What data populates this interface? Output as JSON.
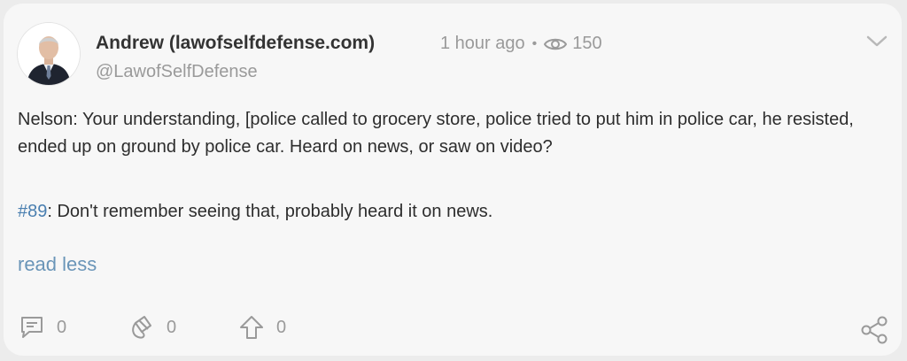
{
  "post": {
    "author_name": "Andrew (lawofselfdefense.com)",
    "time_ago": "1 hour ago",
    "separator": "•",
    "views": "150",
    "handle": "@LawofSelfDefense",
    "body_line1": "Nelson: Your understanding, [police called to grocery store, police tried to put him in police car, he resisted, ended up on ground by police car. Heard on news, or saw on video?",
    "body_tag": "#89",
    "body_line2_rest": ": Don't remember seeing that, probably heard it on news.",
    "read_less": "read less"
  },
  "actions": {
    "comments": "0",
    "reposts": "0",
    "upvotes": "0"
  },
  "icons": [
    "chevron-down-icon",
    "eye-icon",
    "comment-icon",
    "repost-icon",
    "upvote-icon",
    "share-icon"
  ],
  "colors": {
    "card_bg": "#f7f7f7",
    "page_bg": "#ececec",
    "link": "#6a95b8",
    "hashtag": "#4a7fb0",
    "muted": "#9a9a9a"
  }
}
